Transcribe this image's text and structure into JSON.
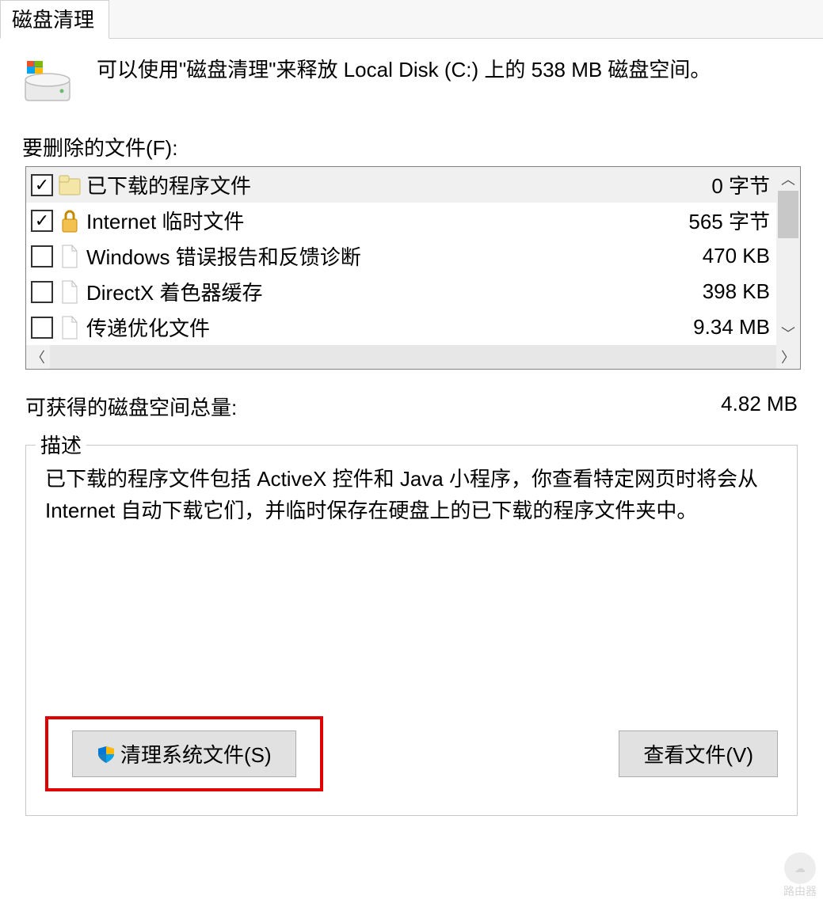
{
  "tab": {
    "label": "磁盘清理"
  },
  "intro": "可以使用\"磁盘清理\"来释放 Local Disk (C:) 上的 538 MB 磁盘空间。",
  "files_label": "要删除的文件(F):",
  "files": [
    {
      "checked": true,
      "icon": "folder",
      "label": "已下载的程序文件",
      "size": "0 字节",
      "highlight": true
    },
    {
      "checked": true,
      "icon": "lock",
      "label": "Internet 临时文件",
      "size": "565 字节",
      "highlight": false
    },
    {
      "checked": false,
      "icon": "file",
      "label": "Windows 错误报告和反馈诊断",
      "size": "470 KB",
      "highlight": false
    },
    {
      "checked": false,
      "icon": "file",
      "label": "DirectX 着色器缓存",
      "size": "398 KB",
      "highlight": false
    },
    {
      "checked": false,
      "icon": "file",
      "label": "传递优化文件",
      "size": "9.34 MB",
      "highlight": false
    }
  ],
  "total": {
    "label": "可获得的磁盘空间总量:",
    "value": "4.82 MB"
  },
  "description": {
    "legend": "描述",
    "text": "已下载的程序文件包括 ActiveX 控件和 Java 小程序，你查看特定网页时将会从 Internet 自动下载它们，并临时保存在硬盘上的已下载的程序文件夹中。"
  },
  "buttons": {
    "clean_system": "清理系统文件(S)",
    "view_files": "查看文件(V)"
  },
  "watermark": "路由器"
}
